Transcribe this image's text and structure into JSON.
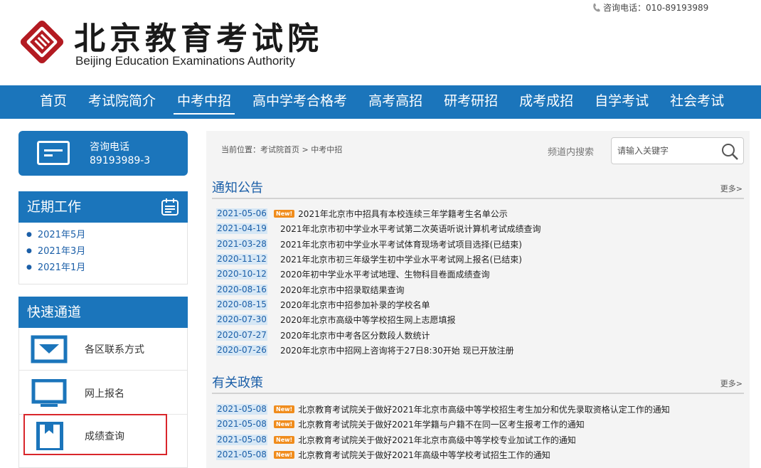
{
  "header": {
    "logo_cn": "北京教育考试院",
    "logo_en": "Beijing Education Examinations Authority",
    "hotline": "咨询电话：010-89193989"
  },
  "nav": {
    "items": [
      "首页",
      "考试院简介",
      "中考中招",
      "高中学考合格考",
      "高考高招",
      "研考研招",
      "成考成招",
      "自学考试",
      "社会考试"
    ],
    "active": "中考中招"
  },
  "sidebar": {
    "phone_label": "咨询电话",
    "phone_number": "89193989-3",
    "recent_title": "近期工作",
    "recent_items": [
      "2021年5月",
      "2021年3月",
      "2021年1月"
    ],
    "quick_title": "快速通道",
    "quick_items": [
      "各区联系方式",
      "网上报名",
      "成绩查询"
    ]
  },
  "main": {
    "breadcrumb": "当前位置：考试院首页 > 中考中招",
    "search_label": "频道内搜索",
    "search_placeholder": "请输入关键字",
    "notice_title": "通知公告",
    "more": "更多>",
    "notices": [
      {
        "date": "2021-05-06",
        "new": "New!",
        "title": "2021年北京市中招具有本校连续三年学籍考生名单公示"
      },
      {
        "date": "2021-04-19",
        "title": "2021年北京市初中学业水平考试第二次英语听说计算机考试成绩查询"
      },
      {
        "date": "2021-03-28",
        "title": "2021年北京市初中学业水平考试体育现场考试项目选择(已结束)"
      },
      {
        "date": "2020-11-12",
        "title": "2021年北京市初三年级学生初中学业水平考试网上报名(已结束)"
      },
      {
        "date": "2020-10-12",
        "title": "2020年初中学业水平考试地理、生物科目卷面成绩查询"
      },
      {
        "date": "2020-08-16",
        "title": "2020年北京市中招录取结果查询"
      },
      {
        "date": "2020-08-15",
        "title": "2020年北京市中招参加补录的学校名单"
      },
      {
        "date": "2020-07-30",
        "title": "2020年北京市高级中等学校招生网上志愿填报"
      },
      {
        "date": "2020-07-27",
        "title": "2020年北京市中考各区分数段人数统计"
      },
      {
        "date": "2020-07-26",
        "title": "2020年北京市中招网上咨询将于27日8:30开始 现已开放注册"
      }
    ],
    "policy_title": "有关政策",
    "policies": [
      {
        "date": "2021-05-08",
        "new": "New!",
        "title": "北京教育考试院关于做好2021年北京市高级中等学校招生考生加分和优先录取资格认定工作的通知"
      },
      {
        "date": "2021-05-08",
        "new": "New!",
        "title": "北京教育考试院关于做好2021年学籍与户籍不在同一区考生报考工作的通知"
      },
      {
        "date": "2021-05-08",
        "new": "New!",
        "title": "北京教育考试院关于做好2021年北京市高级中等学校专业加试工作的通知"
      },
      {
        "date": "2021-05-08",
        "new": "New!",
        "title": "北京教育考试院关于做好2021年高级中等学校考试招生工作的通知"
      }
    ]
  },
  "colors": {
    "brand_blue": "#1b75bb",
    "link_blue": "#1b5fa8",
    "new_orange": "#f08c1c",
    "highlight_red": "#d9262b"
  }
}
